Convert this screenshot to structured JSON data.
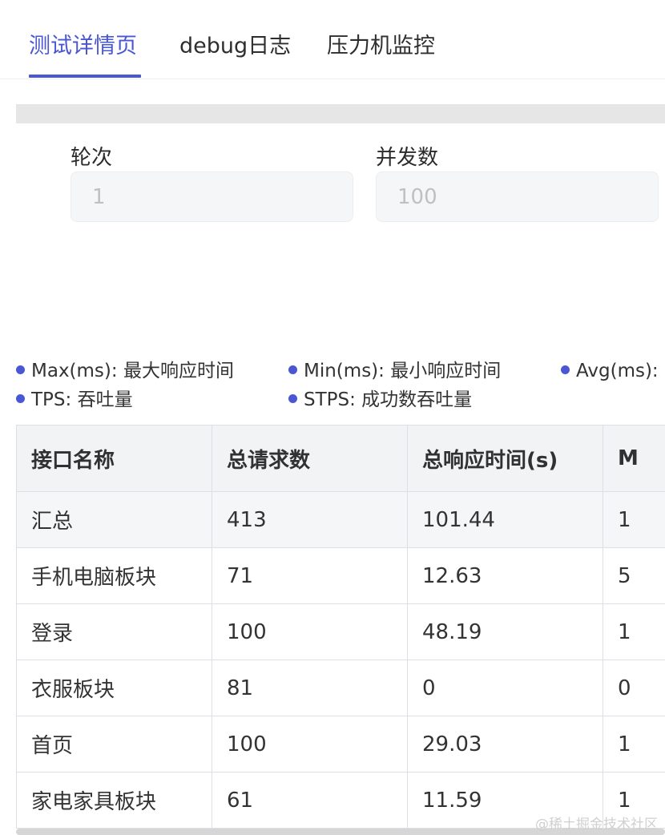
{
  "tabs": [
    {
      "label": "测试详情页",
      "active": true
    },
    {
      "label": "debug日志",
      "active": false
    },
    {
      "label": "压力机监控",
      "active": false
    }
  ],
  "form": {
    "rounds_label": "轮次",
    "rounds_value": "1",
    "concurrency_label": "并发数",
    "concurrency_value": "100"
  },
  "legend": [
    {
      "text": "Max(ms): 最大响应时间"
    },
    {
      "text": "Min(ms): 最小响应时间"
    },
    {
      "text": "Avg(ms): 平"
    },
    {
      "text": "TPS: 吞吐量"
    },
    {
      "text": "STPS: 成功数吞吐量"
    }
  ],
  "table": {
    "headers": [
      "接口名称",
      "总请求数",
      "总响应时间(s)",
      "M"
    ],
    "rows": [
      [
        "汇总",
        "413",
        "101.44",
        "1"
      ],
      [
        "手机电脑板块",
        "71",
        "12.63",
        "5"
      ],
      [
        "登录",
        "100",
        "48.19",
        "1"
      ],
      [
        "衣服板块",
        "81",
        "0",
        "0"
      ],
      [
        "首页",
        "100",
        "29.03",
        "1"
      ],
      [
        "家电家具板块",
        "61",
        "11.59",
        "1"
      ]
    ]
  },
  "watermark": "@稀土掘金技术社区",
  "colors": {
    "accent": "#4a57d4"
  }
}
